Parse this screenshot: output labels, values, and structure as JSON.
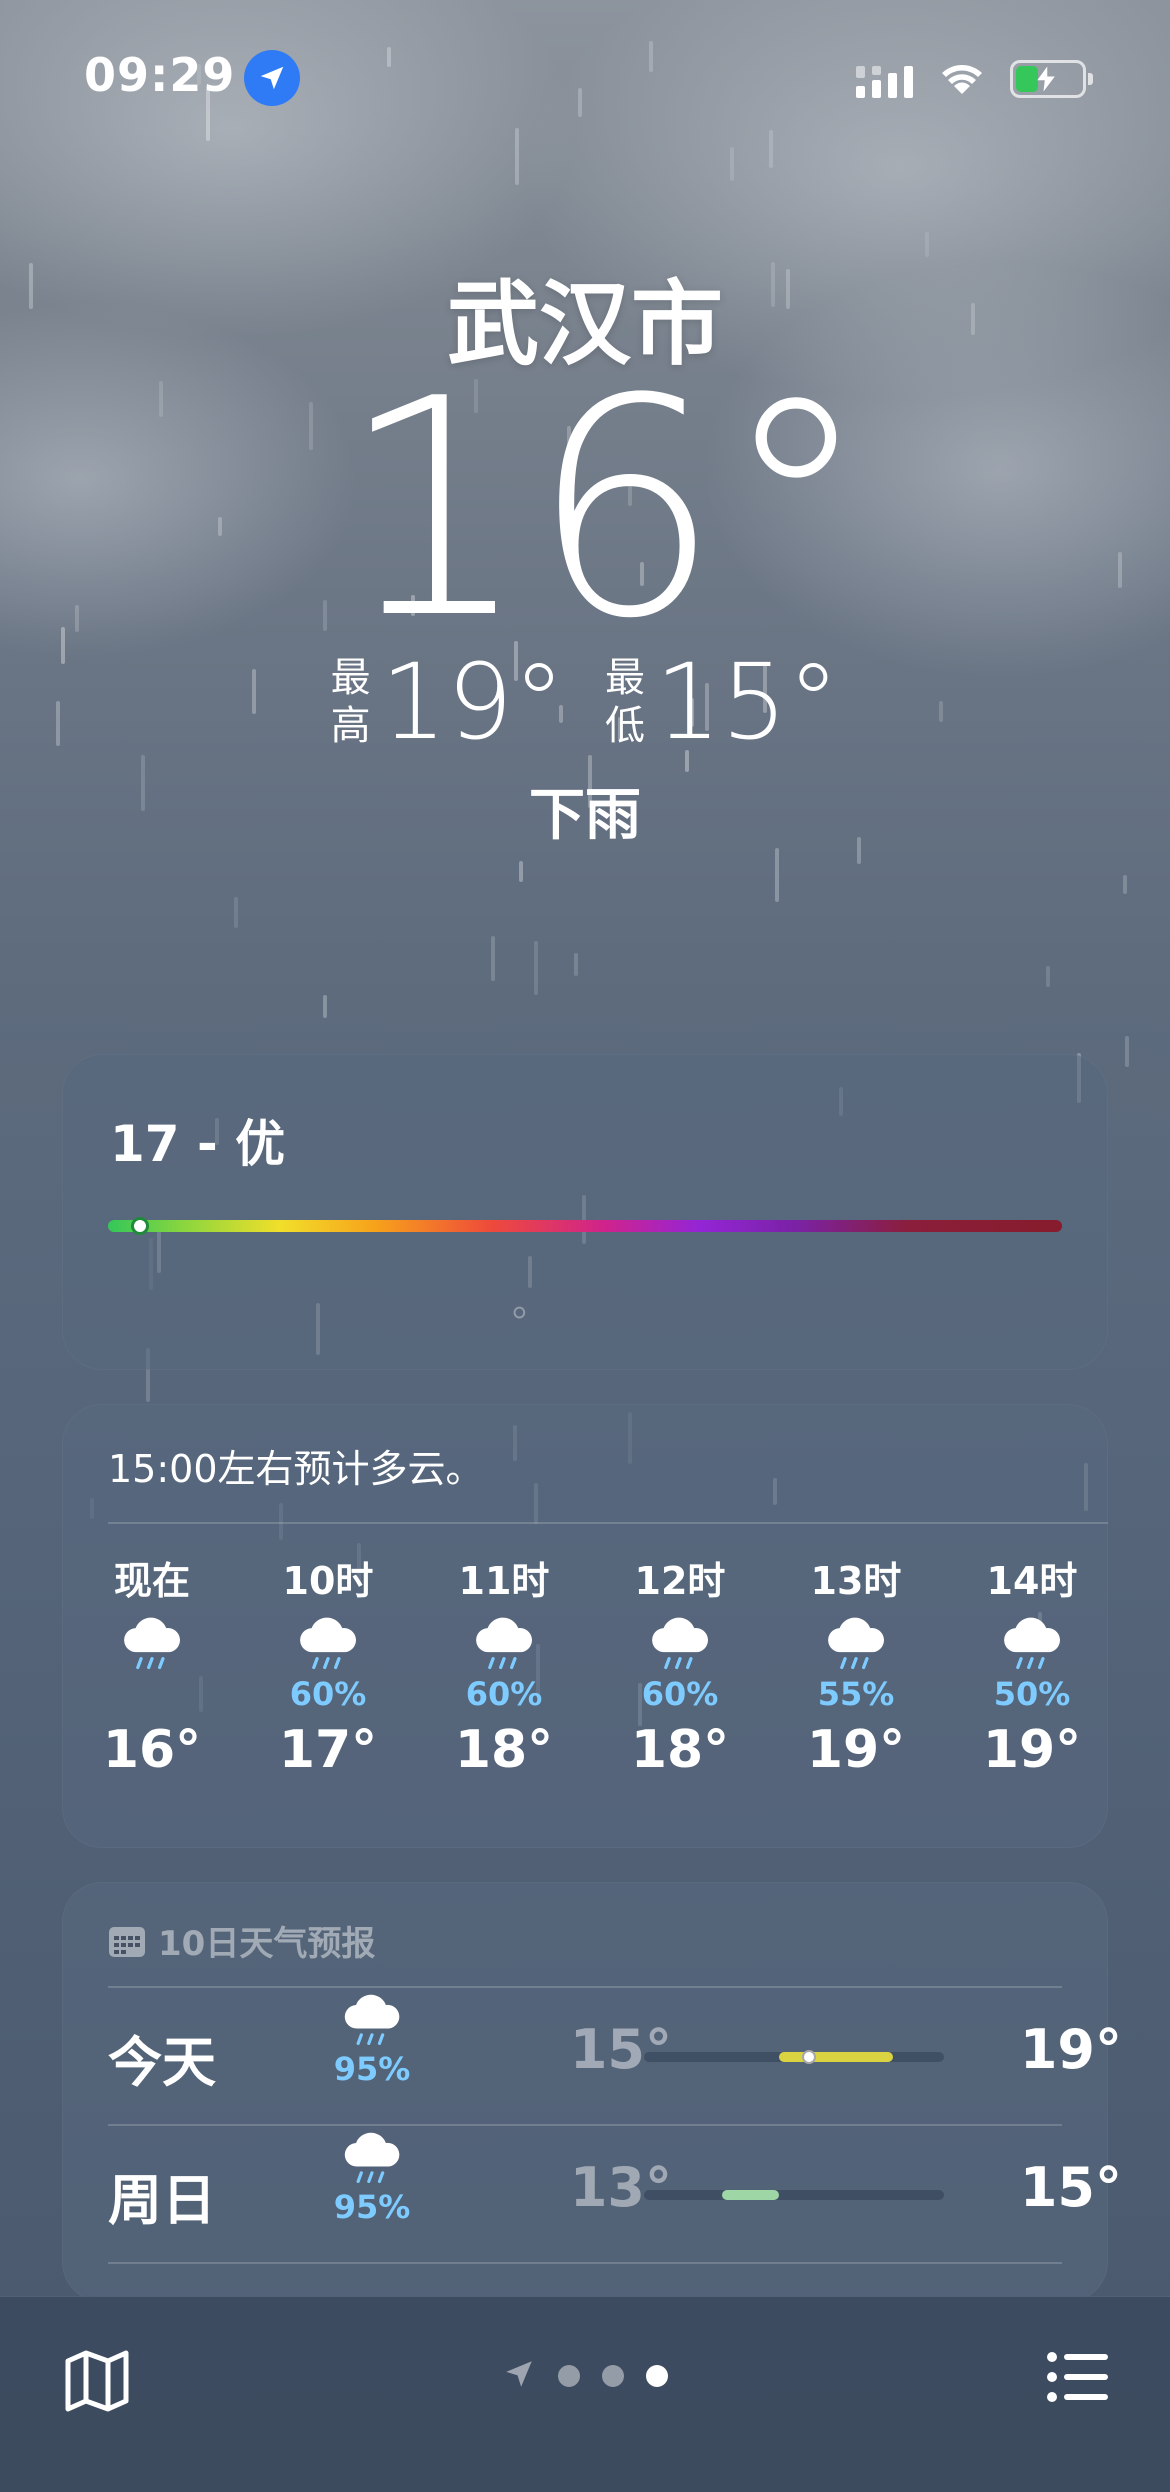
{
  "status_bar": {
    "time": "09:29",
    "location_icon": "location-arrow-icon",
    "signal_icon": "cellular-signal-icon",
    "wifi_icon": "wifi-icon",
    "battery_icon": "battery-charging-icon",
    "battery_level": 0.35,
    "battery_color": "#35c759"
  },
  "current": {
    "city": "武汉市",
    "temperature": "16°",
    "high_label": [
      "最",
      "高"
    ],
    "high": "19°",
    "low_label": [
      "最",
      "低"
    ],
    "low": "15°",
    "condition": "下雨"
  },
  "aqi": {
    "title": "17 - 优",
    "value": 17,
    "scale_max": 500,
    "note": "。"
  },
  "hourly": {
    "summary": "15:00左右预计多云。",
    "items": [
      {
        "label": "现在",
        "icon": "cloud-rain-icon",
        "precip": "",
        "temp": "16°"
      },
      {
        "label": "10时",
        "icon": "cloud-rain-icon",
        "precip": "60%",
        "temp": "17°"
      },
      {
        "label": "11时",
        "icon": "cloud-rain-icon",
        "precip": "60%",
        "temp": "18°"
      },
      {
        "label": "12时",
        "icon": "cloud-rain-icon",
        "precip": "60%",
        "temp": "18°"
      },
      {
        "label": "13时",
        "icon": "cloud-rain-icon",
        "precip": "55%",
        "temp": "19°"
      },
      {
        "label": "14时",
        "icon": "cloud-rain-icon",
        "precip": "50%",
        "temp": "19°"
      }
    ]
  },
  "daily": {
    "header": "10日天气预报",
    "header_icon": "calendar-icon",
    "rows": [
      {
        "day": "今天",
        "icon": "cloud-rain-icon",
        "precip": "95%",
        "low": "15°",
        "high": "19°",
        "range_start": 0.45,
        "range_end": 0.83,
        "range_color": "#d9d342",
        "current_marker": 0.55
      },
      {
        "day": "周日",
        "icon": "cloud-rain-icon",
        "precip": "95%",
        "low": "13°",
        "high": "15°",
        "range_start": 0.26,
        "range_end": 0.45,
        "range_color": "#9fd6a6",
        "current_marker": null
      }
    ]
  },
  "toolbar": {
    "map_icon": "map-icon",
    "list_icon": "list-icon",
    "pages": [
      "location",
      "page",
      "page",
      "page-current"
    ],
    "current_page": 3
  }
}
